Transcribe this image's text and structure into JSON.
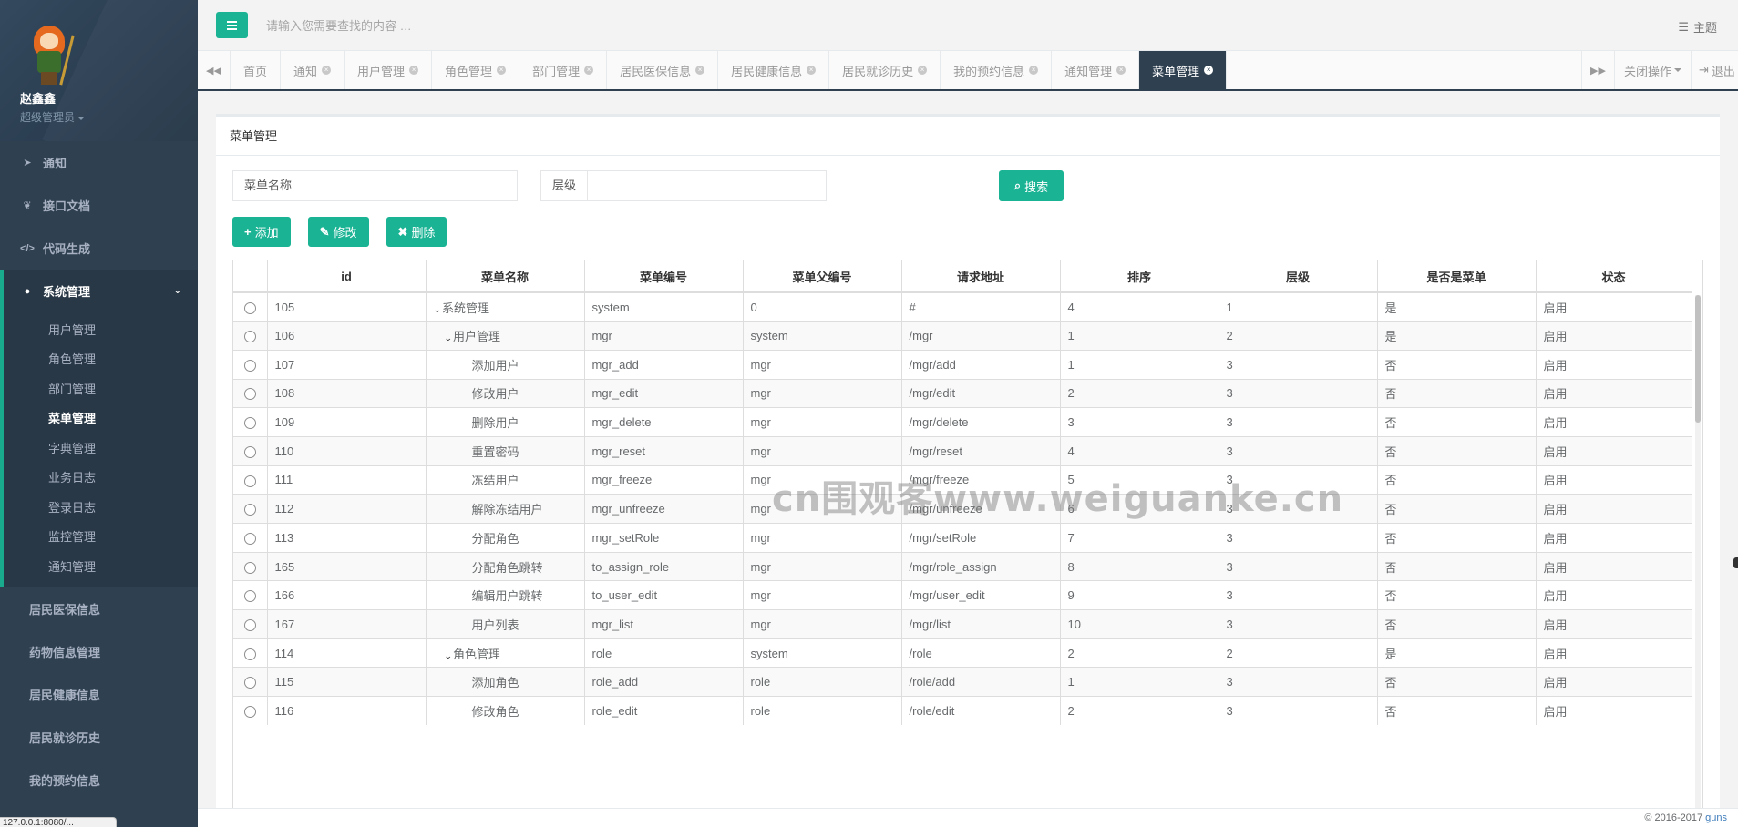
{
  "user": {
    "name": "赵鑫鑫",
    "role": "超级管理员"
  },
  "sidebar": {
    "items": [
      {
        "label": "通知",
        "icon": "paper-plane-icon"
      },
      {
        "label": "接口文档",
        "icon": "leaf-icon"
      },
      {
        "label": "代码生成",
        "icon": "code-icon"
      },
      {
        "label": "系统管理",
        "icon": "user-icon",
        "active": true
      }
    ],
    "subitems": [
      "用户管理",
      "角色管理",
      "部门管理",
      "菜单管理",
      "字典管理",
      "业务日志",
      "登录日志",
      "监控管理",
      "通知管理"
    ],
    "active_subitem": "菜单管理",
    "more_items": [
      "居民医保信息",
      "药物信息管理",
      "居民健康信息",
      "居民就诊历史",
      "我的预约信息"
    ],
    "url_hint": "127.0.0.1:8080/..."
  },
  "header": {
    "search_placeholder": "请输入您需要查找的内容 …",
    "theme_label": "主题"
  },
  "tabs": {
    "items": [
      "首页",
      "通知",
      "用户管理",
      "角色管理",
      "部门管理",
      "居民医保信息",
      "居民健康信息",
      "居民就诊历史",
      "我的预约信息",
      "通知管理",
      "菜单管理"
    ],
    "closable_from": 1,
    "active_index": 10,
    "close_ops_label": "关闭操作",
    "logout_label": "退出"
  },
  "panel": {
    "title": "菜单管理",
    "search": {
      "name_label": "菜单名称",
      "level_label": "层级",
      "button_label": "搜索"
    },
    "buttons": {
      "add": "添加",
      "edit": "修改",
      "delete": "删除"
    }
  },
  "table": {
    "columns": [
      "id",
      "菜单名称",
      "菜单编号",
      "菜单父编号",
      "请求地址",
      "排序",
      "层级",
      "是否是菜单",
      "状态"
    ],
    "rows": [
      {
        "id": "105",
        "name": "系统管理",
        "depth": 0,
        "expanded": true,
        "code": "system",
        "parent": "0",
        "url": "#",
        "sort": "4",
        "level": "1",
        "is_menu": "是",
        "status": "启用"
      },
      {
        "id": "106",
        "name": "用户管理",
        "depth": 1,
        "expanded": true,
        "code": "mgr",
        "parent": "system",
        "url": "/mgr",
        "sort": "1",
        "level": "2",
        "is_menu": "是",
        "status": "启用"
      },
      {
        "id": "107",
        "name": "添加用户",
        "depth": 2,
        "expanded": false,
        "code": "mgr_add",
        "parent": "mgr",
        "url": "/mgr/add",
        "sort": "1",
        "level": "3",
        "is_menu": "否",
        "status": "启用"
      },
      {
        "id": "108",
        "name": "修改用户",
        "depth": 2,
        "expanded": false,
        "code": "mgr_edit",
        "parent": "mgr",
        "url": "/mgr/edit",
        "sort": "2",
        "level": "3",
        "is_menu": "否",
        "status": "启用"
      },
      {
        "id": "109",
        "name": "删除用户",
        "depth": 2,
        "expanded": false,
        "code": "mgr_delete",
        "parent": "mgr",
        "url": "/mgr/delete",
        "sort": "3",
        "level": "3",
        "is_menu": "否",
        "status": "启用"
      },
      {
        "id": "110",
        "name": "重置密码",
        "depth": 2,
        "expanded": false,
        "code": "mgr_reset",
        "parent": "mgr",
        "url": "/mgr/reset",
        "sort": "4",
        "level": "3",
        "is_menu": "否",
        "status": "启用"
      },
      {
        "id": "111",
        "name": "冻结用户",
        "depth": 2,
        "expanded": false,
        "code": "mgr_freeze",
        "parent": "mgr",
        "url": "/mgr/freeze",
        "sort": "5",
        "level": "3",
        "is_menu": "否",
        "status": "启用"
      },
      {
        "id": "112",
        "name": "解除冻结用户",
        "depth": 2,
        "expanded": false,
        "code": "mgr_unfreeze",
        "parent": "mgr",
        "url": "/mgr/unfreeze",
        "sort": "6",
        "level": "3",
        "is_menu": "否",
        "status": "启用"
      },
      {
        "id": "113",
        "name": "分配角色",
        "depth": 2,
        "expanded": false,
        "code": "mgr_setRole",
        "parent": "mgr",
        "url": "/mgr/setRole",
        "sort": "7",
        "level": "3",
        "is_menu": "否",
        "status": "启用"
      },
      {
        "id": "165",
        "name": "分配角色跳转",
        "depth": 2,
        "expanded": false,
        "code": "to_assign_role",
        "parent": "mgr",
        "url": "/mgr/role_assign",
        "sort": "8",
        "level": "3",
        "is_menu": "否",
        "status": "启用"
      },
      {
        "id": "166",
        "name": "编辑用户跳转",
        "depth": 2,
        "expanded": false,
        "code": "to_user_edit",
        "parent": "mgr",
        "url": "/mgr/user_edit",
        "sort": "9",
        "level": "3",
        "is_menu": "否",
        "status": "启用"
      },
      {
        "id": "167",
        "name": "用户列表",
        "depth": 2,
        "expanded": false,
        "code": "mgr_list",
        "parent": "mgr",
        "url": "/mgr/list",
        "sort": "10",
        "level": "3",
        "is_menu": "否",
        "status": "启用"
      },
      {
        "id": "114",
        "name": "角色管理",
        "depth": 1,
        "expanded": true,
        "code": "role",
        "parent": "system",
        "url": "/role",
        "sort": "2",
        "level": "2",
        "is_menu": "是",
        "status": "启用"
      },
      {
        "id": "115",
        "name": "添加角色",
        "depth": 2,
        "expanded": false,
        "code": "role_add",
        "parent": "role",
        "url": "/role/add",
        "sort": "1",
        "level": "3",
        "is_menu": "否",
        "status": "启用"
      },
      {
        "id": "116",
        "name": "修改角色",
        "depth": 2,
        "expanded": false,
        "code": "role_edit",
        "parent": "role",
        "url": "/role/edit",
        "sort": "2",
        "level": "3",
        "is_menu": "否",
        "status": "启用"
      }
    ]
  },
  "watermark": "cn围观客www.weiguanke.cn",
  "footer": {
    "copyright": "© 2016-2017",
    "link": "guns"
  },
  "colors": {
    "sidebar_bg": "#2f4050",
    "accent": "#1ab394"
  }
}
